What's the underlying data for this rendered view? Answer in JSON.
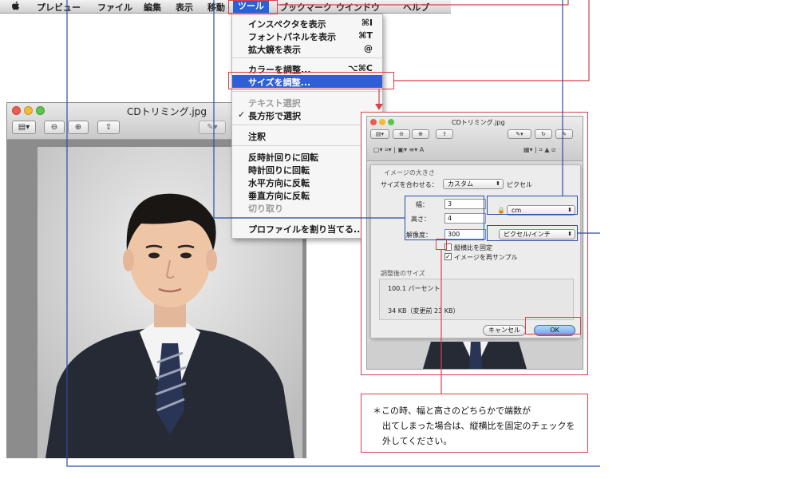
{
  "menubar": {
    "items": [
      "プレビュー",
      "ファイル",
      "編集",
      "表示",
      "移動",
      "ツール",
      "ブックマーク",
      "ウインドウ",
      "ヘルプ"
    ],
    "active_label": "ツール"
  },
  "tools_menu": {
    "show_inspector": {
      "label": "インスペクタを表示",
      "shortcut": "⌘I"
    },
    "show_fonts": {
      "label": "フォントパネルを表示",
      "shortcut": "⌘T"
    },
    "show_magnifier": {
      "label": "拡大鏡を表示",
      "shortcut": "@"
    },
    "adjust_color": {
      "label": "カラーを調整...",
      "shortcut": "⌥⌘C"
    },
    "adjust_size": {
      "label": "サイズを調整..."
    },
    "text_select": {
      "label": "テキスト選択"
    },
    "rect_select": {
      "label": "長方形で選択",
      "check": "✓"
    },
    "annotate": {
      "label": "注釈"
    },
    "rotate_left": {
      "label": "反時計回りに回転"
    },
    "rotate_right": {
      "label": "時計回りに回転"
    },
    "flip_horizontal": {
      "label": "水平方向に反転"
    },
    "flip_vertical": {
      "label": "垂直方向に反転"
    },
    "crop": {
      "label": "切り取り"
    },
    "assign_profile": {
      "label": "プロファイルを割り当てる..."
    }
  },
  "window": {
    "title": "CDトリミング.jpg"
  },
  "dialog": {
    "title": "CDトリミング.jpg",
    "section_image_size": "イメージの大きさ",
    "fit_label": "サイズを合わせる：",
    "fit_value": "カスタム",
    "fit_unit": "ピクセル",
    "width_label": "幅：",
    "width_value": "3",
    "height_label": "高さ：",
    "height_value": "4",
    "resolution_label": "解像度：",
    "resolution_value": "300",
    "unit_value": "cm",
    "res_unit_value": "ピクセル/インチ",
    "keep_ratio_label": "縦横比を固定",
    "resample_label": "イメージを再サンプル",
    "resample_check": "✓",
    "result_label": "調整後のサイズ",
    "result_percent": "100.1 パーセント",
    "result_size": "34 KB（変更前 23 KB）",
    "cancel_label": "キャンセル",
    "ok_label": "OK"
  },
  "note": {
    "line1": "＊この時、幅と高さのどちらかで端数が",
    "line2": "出てしまった場合は、縦横比を固定のチェックを",
    "line3": "外してください。"
  },
  "colors": {
    "annotation_red": "#d4424a",
    "annotation_blue": "#2b4ea8",
    "menu_highlight": "#2f5fd6"
  }
}
